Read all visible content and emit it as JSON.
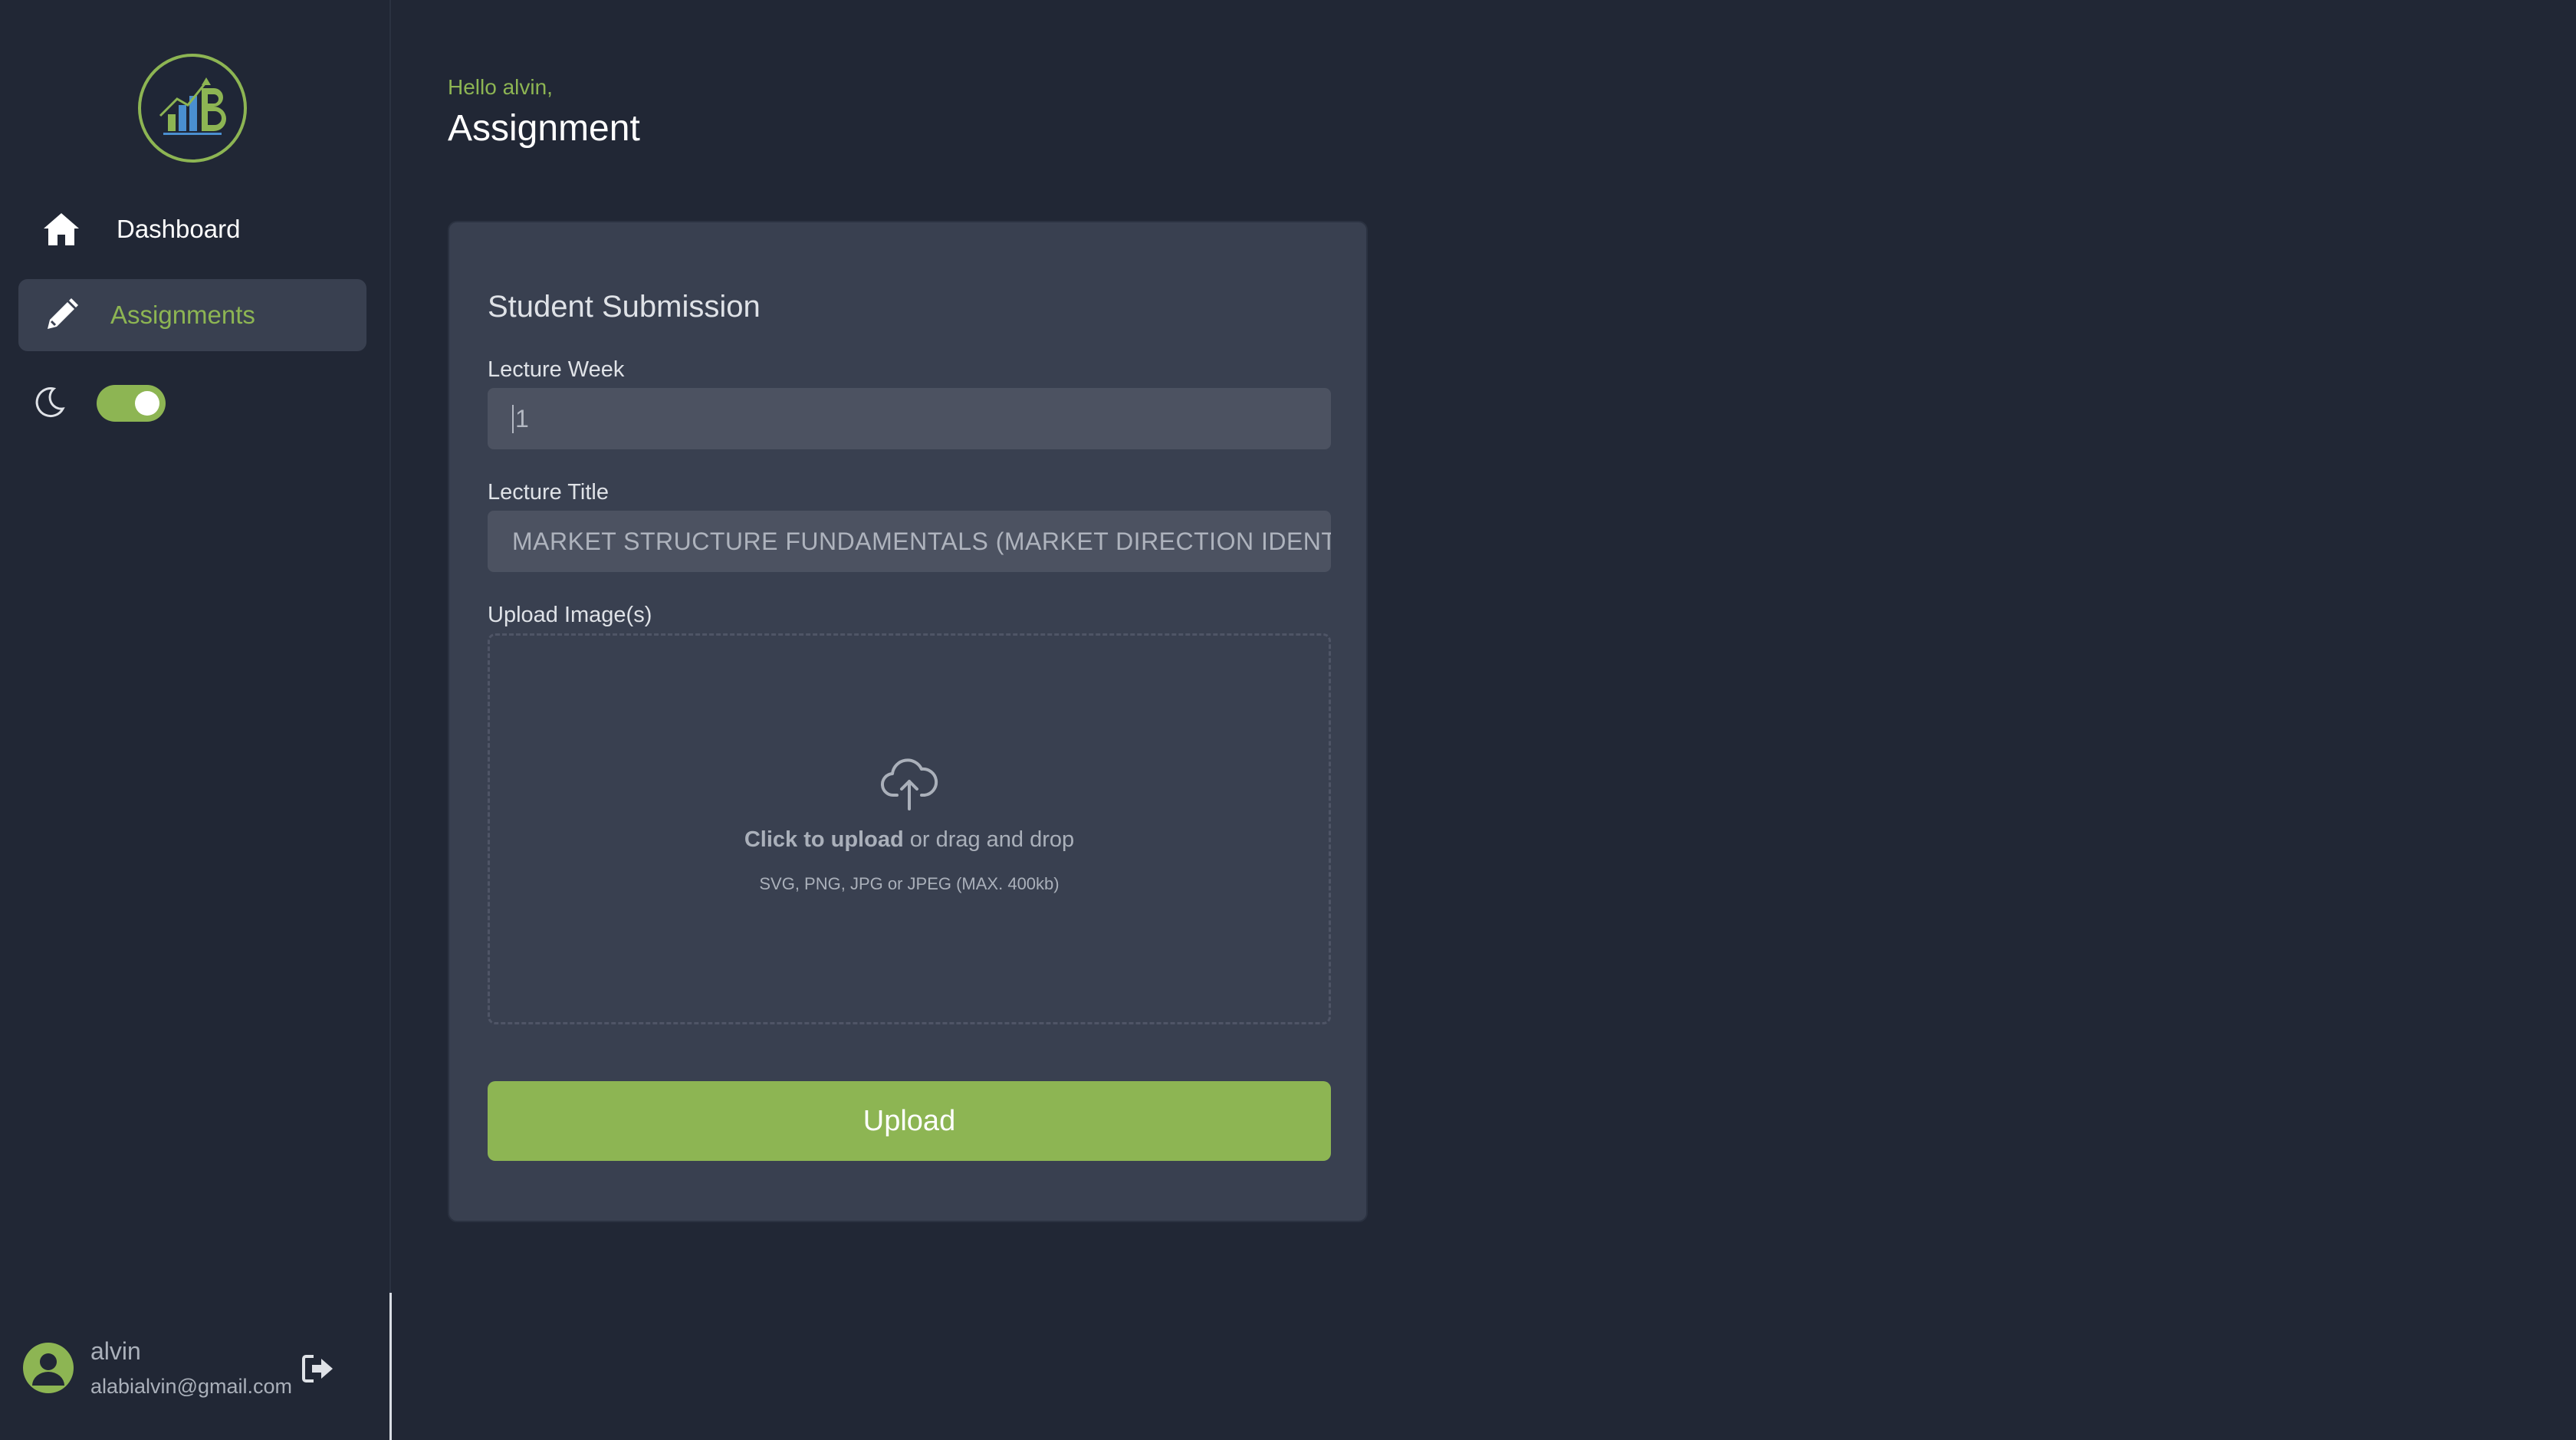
{
  "sidebar": {
    "logo_icon": "chart-logo-icon",
    "nav": [
      {
        "label": "Dashboard",
        "icon": "home-icon"
      },
      {
        "label": "Assignments",
        "icon": "pencil-icon"
      }
    ],
    "theme": {
      "icon": "moon-icon",
      "dark_mode": true
    },
    "user": {
      "name": "alvin",
      "email": "alabialvin@gmail.com",
      "avatar_icon": "user-icon",
      "logout_icon": "logout-icon"
    }
  },
  "header": {
    "greeting": "Hello alvin,",
    "title": "Assignment"
  },
  "form": {
    "title": "Student Submission",
    "lecture_week": {
      "label": "Lecture Week",
      "value": "1"
    },
    "lecture_title": {
      "label": "Lecture Title",
      "value": "MARKET STRUCTURE FUNDAMENTALS (MARKET DIRECTION IDENTI"
    },
    "upload": {
      "label": "Upload Image(s)",
      "icon": "cloud-upload-icon",
      "cta": "Click to upload",
      "cta_suffix": " or drag and drop",
      "hint": "SVG, PNG, JPG or JPEG (MAX. 400kb)"
    },
    "submit_label": "Upload"
  },
  "colors": {
    "background": "#212735",
    "card": "#394050",
    "accent": "#8db553",
    "input": "#4c5261"
  }
}
